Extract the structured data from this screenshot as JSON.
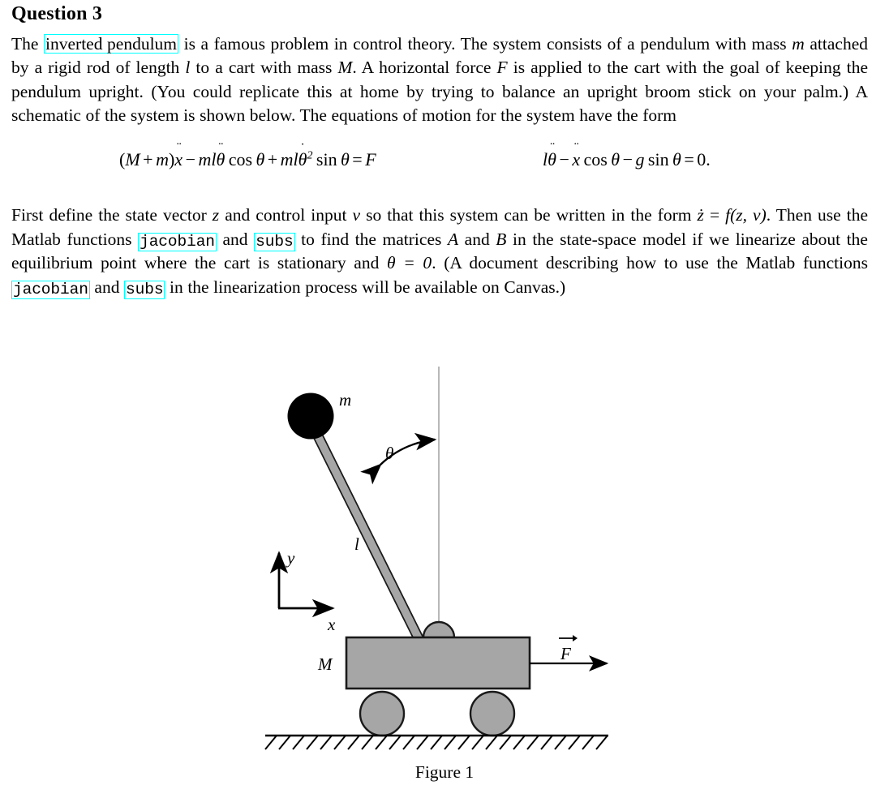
{
  "document": {
    "title": "Question 3",
    "paragraph1": {
      "prefix": "The ",
      "link": "inverted pendulum",
      "rest_line1": " is a famous problem in control theory. The system consists of a pendulum",
      "rest": "with mass m attached by a rigid rod of length l to a cart with mass M. A horizontal force F is applied to the cart with the goal of keeping the pendulum upright. (You could replicate this at home by trying to balance an upright broom stick on your palm.) A schematic of the system is shown below. The equations of motion for the system have the form"
    },
    "equations": {
      "eq1": "(M + m)ẍ − mlθ̈ cos θ + mlθ̇² sin θ = F",
      "eq2": "lθ̈ − ẍ cos θ − g sin θ = 0.",
      "eq1_tokens": {
        "open": "(",
        "M": "M",
        "plus": "+",
        "m": "m",
        "close": ")",
        "xddot": "x",
        "minus1": "−",
        "ml1": "ml",
        "thetaddot": "θ",
        "cos": "cos",
        "theta1": "θ",
        "plus2": "+",
        "ml2": "ml",
        "thetadot": "θ",
        "square": "2",
        "sin": "sin",
        "theta2": "θ",
        "equals": "=",
        "F": "F"
      },
      "eq2_tokens": {
        "l": "l",
        "thetaddot": "θ",
        "minus1": "−",
        "xddot": "x",
        "cos": "cos",
        "theta1": "θ",
        "minus2": "−",
        "g": "g",
        "sin": "sin",
        "theta2": "θ",
        "equals": "=",
        "zero": "0."
      }
    },
    "paragraph2": {
      "seg1": "First define the state vector ",
      "z": "z",
      "seg2": " and control input ",
      "v": "v",
      "seg3": " so that this system can be written in the form ",
      "zdot": "ż",
      "seg4": " = ",
      "fzv": "f(z, v)",
      "seg5": ". Then use the Matlab functions ",
      "link_jacobian_1": "jacobian",
      "seg6": " and ",
      "link_subs_1": "subs",
      "seg7": " to find the matrices ",
      "A": "A",
      "seg8": " and ",
      "B": "B",
      "seg9": " in the state-space model if we linearize about the equilibrium point where the cart is stationary and ",
      "theta_eq": "θ = 0",
      "seg10": ". (A document describing how to use the Matlab functions ",
      "link_jacobian_2": "jacobian",
      "seg11": " and ",
      "link_subs_2": "subs",
      "seg12": " in the linearization process will be available on Canvas.)"
    },
    "figure": {
      "caption": "Figure 1",
      "labels": {
        "mass_bob": "m",
        "rod_length": "l",
        "angle": "θ",
        "cart_mass": "M",
        "force": "F",
        "axis_x": "x",
        "axis_y": "y"
      }
    }
  },
  "colors": {
    "link_box": "#00ffff",
    "gray_fill": "#a6a6a6",
    "outline": "#1a1a1a",
    "bob": "#000000",
    "reference_line": "#9a9a9a",
    "page_background": "#ffffff",
    "text": "#000000"
  }
}
